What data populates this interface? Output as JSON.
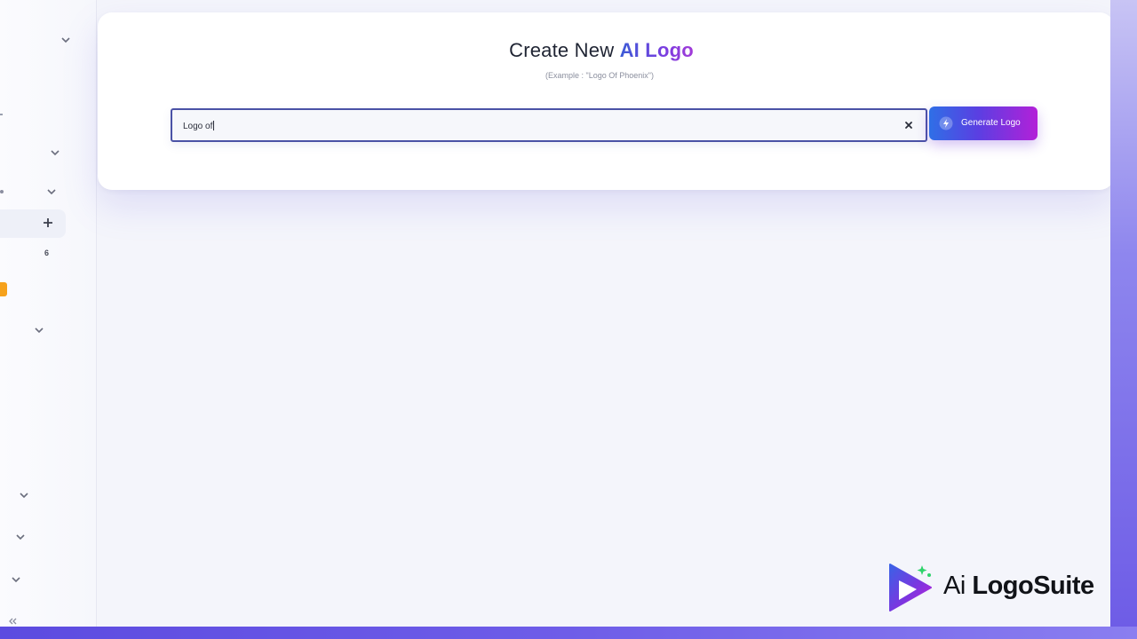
{
  "header": {
    "title_prefix": "Create New ",
    "title_accent": "AI Logo",
    "subtitle": "(Example : \"Logo Of Phoenix\")"
  },
  "search": {
    "value": "Logo of",
    "clear_icon": "close-icon"
  },
  "actions": {
    "generate_label": "Generate Logo",
    "generate_icon": "sparkle-bolt-icon"
  },
  "sidebar": {
    "count_badge": "6",
    "add_icon": "plus-icon",
    "chevron_icon": "chevron-down-icon",
    "collapse_icon": "double-chevron-left-icon"
  },
  "brand": {
    "prefix": "Ai",
    "name": "LogoSuite"
  },
  "colors": {
    "accent_blue": "#3b5bd6",
    "accent_purple": "#a23ad8",
    "input_border": "#4a52a6",
    "badge_orange": "#f6a21c"
  }
}
